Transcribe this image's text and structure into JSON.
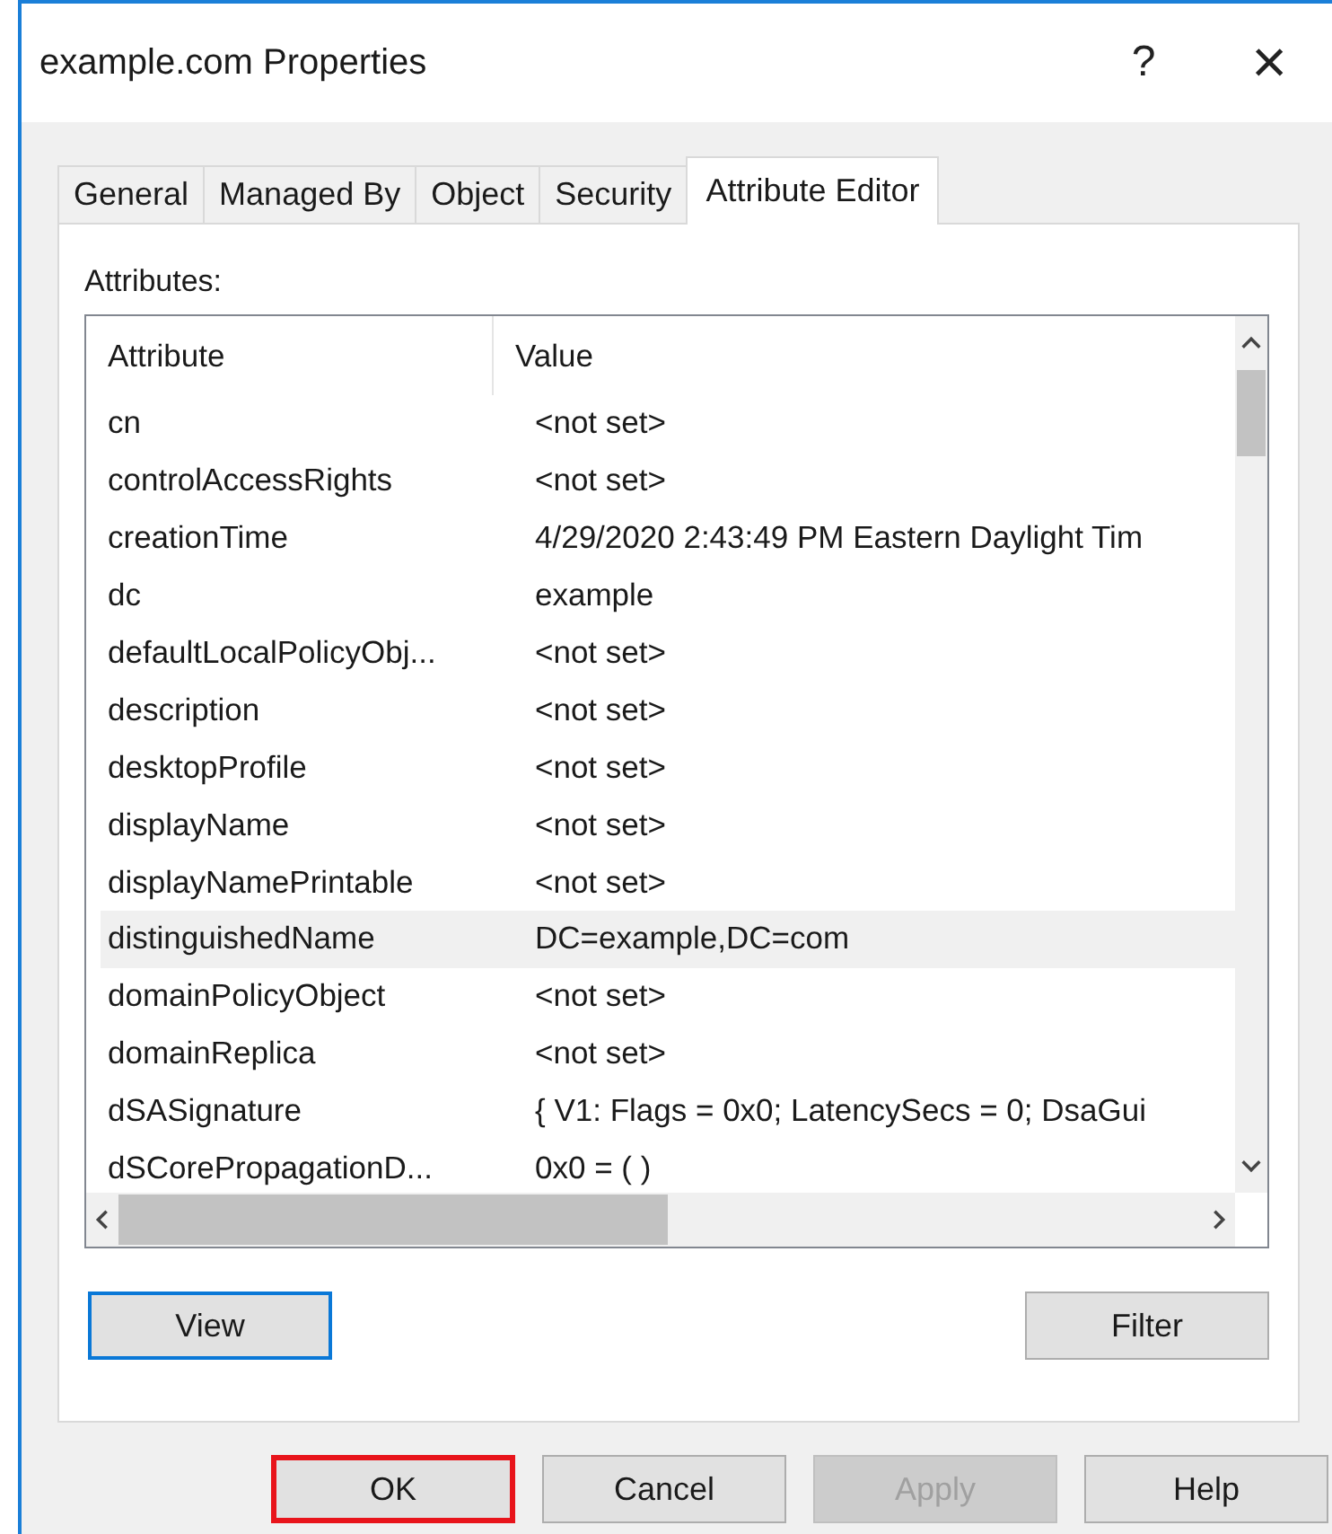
{
  "window": {
    "title": "example.com Properties",
    "help": "?",
    "close": "×"
  },
  "tabs": [
    {
      "label": "General",
      "selected": false
    },
    {
      "label": "Managed By",
      "selected": false
    },
    {
      "label": "Object",
      "selected": false
    },
    {
      "label": "Security",
      "selected": false
    },
    {
      "label": "Attribute Editor",
      "selected": true
    }
  ],
  "attributes": {
    "label": "Attributes:",
    "columns": [
      "Attribute",
      "Value"
    ],
    "rows": [
      {
        "name": "cn",
        "value": "<not set>",
        "selected": false
      },
      {
        "name": "controlAccessRights",
        "value": "<not set>",
        "selected": false
      },
      {
        "name": "creationTime",
        "value": "4/29/2020 2:43:49 PM Eastern Daylight Tim",
        "selected": false
      },
      {
        "name": "dc",
        "value": "example",
        "selected": false
      },
      {
        "name": "defaultLocalPolicyObj...",
        "value": "<not set>",
        "selected": false
      },
      {
        "name": "description",
        "value": "<not set>",
        "selected": false
      },
      {
        "name": "desktopProfile",
        "value": "<not set>",
        "selected": false
      },
      {
        "name": "displayName",
        "value": "<not set>",
        "selected": false
      },
      {
        "name": "displayNamePrintable",
        "value": "<not set>",
        "selected": false
      },
      {
        "name": "distinguishedName",
        "value": "DC=example,DC=com",
        "selected": true
      },
      {
        "name": "domainPolicyObject",
        "value": "<not set>",
        "selected": false
      },
      {
        "name": "domainReplica",
        "value": "<not set>",
        "selected": false
      },
      {
        "name": "dSASignature",
        "value": "{ V1: Flags = 0x0; LatencySecs = 0; DsaGui",
        "selected": false
      },
      {
        "name": "dSCorePropagationD...",
        "value": "0x0 = ( )",
        "selected": false
      }
    ]
  },
  "panel_buttons": [
    {
      "label": "View",
      "focused": true
    },
    {
      "label": "Filter",
      "focused": false
    }
  ],
  "dialog_buttons": [
    {
      "label": "OK",
      "highlighted": true,
      "disabled": false
    },
    {
      "label": "Cancel",
      "highlighted": false,
      "disabled": false
    },
    {
      "label": "Apply",
      "highlighted": false,
      "disabled": true
    },
    {
      "label": "Help",
      "highlighted": false,
      "disabled": false
    }
  ]
}
